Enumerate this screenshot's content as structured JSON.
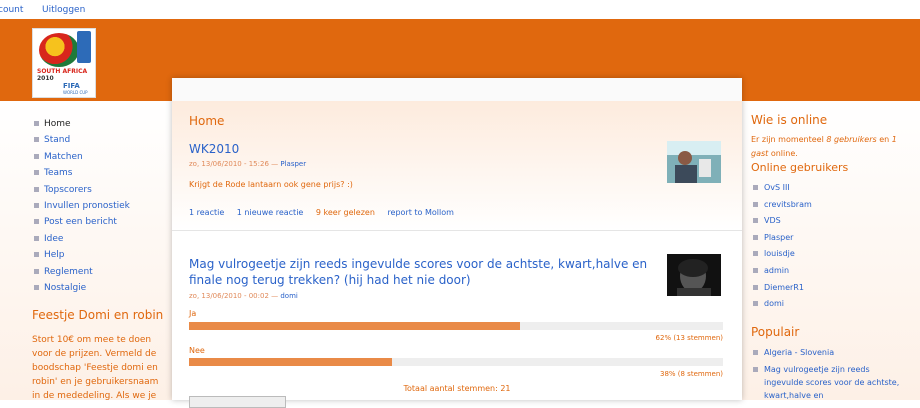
{
  "topbar": {
    "account": "count",
    "logout": "Uitloggen"
  },
  "logo": {
    "line1": "SOUTH AFRICA",
    "line2": "2010",
    "line3": "FIFA",
    "line4": "WORLD CUP"
  },
  "nav": [
    "Home",
    "Stand",
    "Matchen",
    "Teams",
    "Topscorers",
    "Invullen pronostiek",
    "Post een bericht",
    "Idee",
    "Help",
    "Reglement",
    "Nostalgie"
  ],
  "left_block": {
    "title": "Feestje Domi en robin",
    "text": "Stort 10€ om mee te doen voor de prijzen. Vermeld de boodschap 'Feestje domi en robin' en je gebruikersnaam in de mededeling. Als we je"
  },
  "main": {
    "page_title": "Home",
    "post1": {
      "title": "WK2010",
      "date": "zo, 13/06/2010 - 15:26 — ",
      "author": "Plasper",
      "body": "Krijgt de Rode lantaarn ook gene prijs? :)",
      "links": [
        "1 reactie",
        "1 nieuwe reactie",
        "9 keer gelezen",
        "report to Mollom"
      ]
    },
    "post2": {
      "title": "Mag vulrogeetje zijn reeds ingevulde scores voor de achtste, kwart,halve en finale nog terug trekken? (hij had het nie door)",
      "date": "zo, 13/06/2010 - 00:02 — ",
      "author": "domi",
      "poll": [
        {
          "label": "Ja",
          "percent": 62,
          "result": "62% (13 stemmen)"
        },
        {
          "label": "Nee",
          "percent": 38,
          "result": "38% (8 stemmen)"
        }
      ],
      "total": "Totaal aantal stemmen: 21"
    }
  },
  "right": {
    "who_title": "Wie is online",
    "who_text_pre": "Er zijn momenteel ",
    "who_users": "8 gebruikers",
    "who_mid": " en ",
    "who_guests": "1 gast",
    "who_post": " online.",
    "online_title": "Online gebruikers",
    "online": [
      "OvS III",
      "crevitsbram",
      "VDS",
      "Plasper",
      "louisdje",
      "admin",
      "DiemerR1",
      "domi"
    ],
    "popular_title": "Populair",
    "popular": [
      "Algeria - Slovenia",
      "Mag vulrogeetje zijn reeds ingevulde scores voor de achtste, kwart,halve en"
    ]
  },
  "colors": {
    "accent": "#e0680e",
    "link": "#2a62c9",
    "bar": "#e98a47"
  }
}
